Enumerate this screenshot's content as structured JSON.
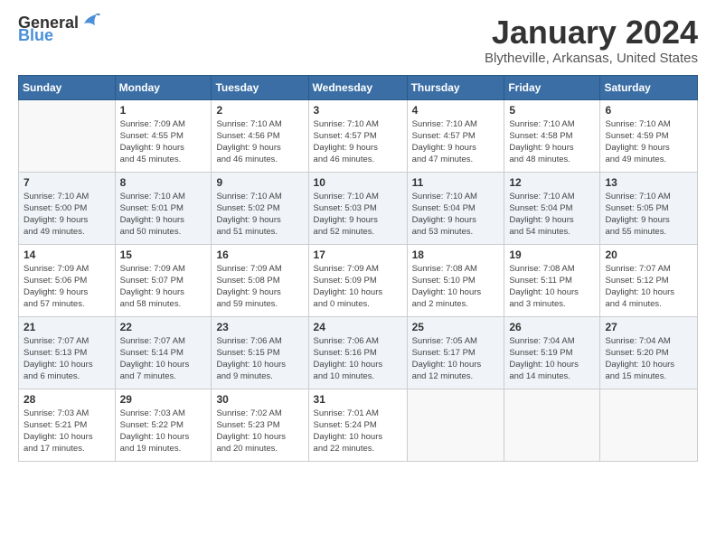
{
  "header": {
    "logo_general": "General",
    "logo_blue": "Blue",
    "month_year": "January 2024",
    "location": "Blytheville, Arkansas, United States"
  },
  "weekdays": [
    "Sunday",
    "Monday",
    "Tuesday",
    "Wednesday",
    "Thursday",
    "Friday",
    "Saturday"
  ],
  "weeks": [
    [
      {
        "day": "",
        "info": ""
      },
      {
        "day": "1",
        "info": "Sunrise: 7:09 AM\nSunset: 4:55 PM\nDaylight: 9 hours\nand 45 minutes."
      },
      {
        "day": "2",
        "info": "Sunrise: 7:10 AM\nSunset: 4:56 PM\nDaylight: 9 hours\nand 46 minutes."
      },
      {
        "day": "3",
        "info": "Sunrise: 7:10 AM\nSunset: 4:57 PM\nDaylight: 9 hours\nand 46 minutes."
      },
      {
        "day": "4",
        "info": "Sunrise: 7:10 AM\nSunset: 4:57 PM\nDaylight: 9 hours\nand 47 minutes."
      },
      {
        "day": "5",
        "info": "Sunrise: 7:10 AM\nSunset: 4:58 PM\nDaylight: 9 hours\nand 48 minutes."
      },
      {
        "day": "6",
        "info": "Sunrise: 7:10 AM\nSunset: 4:59 PM\nDaylight: 9 hours\nand 49 minutes."
      }
    ],
    [
      {
        "day": "7",
        "info": "Sunrise: 7:10 AM\nSunset: 5:00 PM\nDaylight: 9 hours\nand 49 minutes."
      },
      {
        "day": "8",
        "info": "Sunrise: 7:10 AM\nSunset: 5:01 PM\nDaylight: 9 hours\nand 50 minutes."
      },
      {
        "day": "9",
        "info": "Sunrise: 7:10 AM\nSunset: 5:02 PM\nDaylight: 9 hours\nand 51 minutes."
      },
      {
        "day": "10",
        "info": "Sunrise: 7:10 AM\nSunset: 5:03 PM\nDaylight: 9 hours\nand 52 minutes."
      },
      {
        "day": "11",
        "info": "Sunrise: 7:10 AM\nSunset: 5:04 PM\nDaylight: 9 hours\nand 53 minutes."
      },
      {
        "day": "12",
        "info": "Sunrise: 7:10 AM\nSunset: 5:04 PM\nDaylight: 9 hours\nand 54 minutes."
      },
      {
        "day": "13",
        "info": "Sunrise: 7:10 AM\nSunset: 5:05 PM\nDaylight: 9 hours\nand 55 minutes."
      }
    ],
    [
      {
        "day": "14",
        "info": "Sunrise: 7:09 AM\nSunset: 5:06 PM\nDaylight: 9 hours\nand 57 minutes."
      },
      {
        "day": "15",
        "info": "Sunrise: 7:09 AM\nSunset: 5:07 PM\nDaylight: 9 hours\nand 58 minutes."
      },
      {
        "day": "16",
        "info": "Sunrise: 7:09 AM\nSunset: 5:08 PM\nDaylight: 9 hours\nand 59 minutes."
      },
      {
        "day": "17",
        "info": "Sunrise: 7:09 AM\nSunset: 5:09 PM\nDaylight: 10 hours\nand 0 minutes."
      },
      {
        "day": "18",
        "info": "Sunrise: 7:08 AM\nSunset: 5:10 PM\nDaylight: 10 hours\nand 2 minutes."
      },
      {
        "day": "19",
        "info": "Sunrise: 7:08 AM\nSunset: 5:11 PM\nDaylight: 10 hours\nand 3 minutes."
      },
      {
        "day": "20",
        "info": "Sunrise: 7:07 AM\nSunset: 5:12 PM\nDaylight: 10 hours\nand 4 minutes."
      }
    ],
    [
      {
        "day": "21",
        "info": "Sunrise: 7:07 AM\nSunset: 5:13 PM\nDaylight: 10 hours\nand 6 minutes."
      },
      {
        "day": "22",
        "info": "Sunrise: 7:07 AM\nSunset: 5:14 PM\nDaylight: 10 hours\nand 7 minutes."
      },
      {
        "day": "23",
        "info": "Sunrise: 7:06 AM\nSunset: 5:15 PM\nDaylight: 10 hours\nand 9 minutes."
      },
      {
        "day": "24",
        "info": "Sunrise: 7:06 AM\nSunset: 5:16 PM\nDaylight: 10 hours\nand 10 minutes."
      },
      {
        "day": "25",
        "info": "Sunrise: 7:05 AM\nSunset: 5:17 PM\nDaylight: 10 hours\nand 12 minutes."
      },
      {
        "day": "26",
        "info": "Sunrise: 7:04 AM\nSunset: 5:19 PM\nDaylight: 10 hours\nand 14 minutes."
      },
      {
        "day": "27",
        "info": "Sunrise: 7:04 AM\nSunset: 5:20 PM\nDaylight: 10 hours\nand 15 minutes."
      }
    ],
    [
      {
        "day": "28",
        "info": "Sunrise: 7:03 AM\nSunset: 5:21 PM\nDaylight: 10 hours\nand 17 minutes."
      },
      {
        "day": "29",
        "info": "Sunrise: 7:03 AM\nSunset: 5:22 PM\nDaylight: 10 hours\nand 19 minutes."
      },
      {
        "day": "30",
        "info": "Sunrise: 7:02 AM\nSunset: 5:23 PM\nDaylight: 10 hours\nand 20 minutes."
      },
      {
        "day": "31",
        "info": "Sunrise: 7:01 AM\nSunset: 5:24 PM\nDaylight: 10 hours\nand 22 minutes."
      },
      {
        "day": "",
        "info": ""
      },
      {
        "day": "",
        "info": ""
      },
      {
        "day": "",
        "info": ""
      }
    ]
  ]
}
